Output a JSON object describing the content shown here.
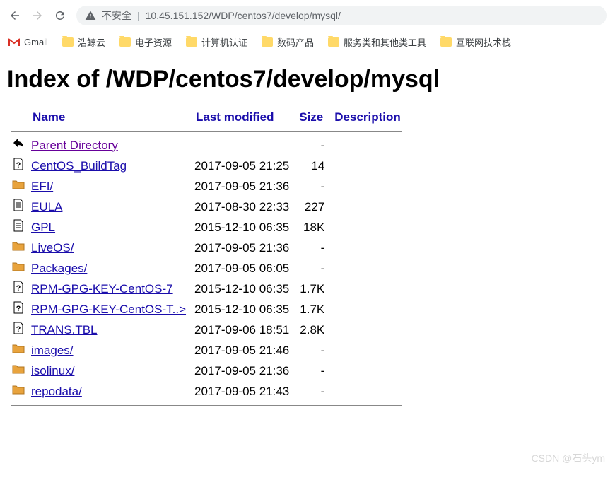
{
  "browser": {
    "security_label": "不安全",
    "url": "10.45.151.152/WDP/centos7/develop/mysql/"
  },
  "bookmarks": [
    {
      "label": "Gmail",
      "icon": "gmail"
    },
    {
      "label": "浩鲸云",
      "icon": "folder"
    },
    {
      "label": "电子资源",
      "icon": "folder"
    },
    {
      "label": "计算机认证",
      "icon": "folder"
    },
    {
      "label": "数码产品",
      "icon": "folder"
    },
    {
      "label": "服务类和其他类工具",
      "icon": "folder"
    },
    {
      "label": "互联网技术栈",
      "icon": "folder"
    }
  ],
  "page": {
    "heading": "Index of /WDP/centos7/develop/mysql",
    "columns": {
      "name": "Name",
      "modified": "Last modified",
      "size": "Size",
      "description": "Description"
    },
    "entries": [
      {
        "icon": "back",
        "name": "Parent Directory",
        "modified": "",
        "size": "-",
        "visited": true
      },
      {
        "icon": "unknown",
        "name": "CentOS_BuildTag",
        "modified": "2017-09-05 21:25",
        "size": "14"
      },
      {
        "icon": "folder",
        "name": "EFI/",
        "modified": "2017-09-05 21:36",
        "size": "-"
      },
      {
        "icon": "text",
        "name": "EULA",
        "modified": "2017-08-30 22:33",
        "size": "227"
      },
      {
        "icon": "text",
        "name": "GPL",
        "modified": "2015-12-10 06:35",
        "size": "18K"
      },
      {
        "icon": "folder",
        "name": "LiveOS/",
        "modified": "2017-09-05 21:36",
        "size": "-"
      },
      {
        "icon": "folder",
        "name": "Packages/",
        "modified": "2017-09-05 06:05",
        "size": "-"
      },
      {
        "icon": "unknown",
        "name": "RPM-GPG-KEY-CentOS-7",
        "modified": "2015-12-10 06:35",
        "size": "1.7K"
      },
      {
        "icon": "unknown",
        "name": "RPM-GPG-KEY-CentOS-T..>",
        "modified": "2015-12-10 06:35",
        "size": "1.7K"
      },
      {
        "icon": "unknown",
        "name": "TRANS.TBL",
        "modified": "2017-09-06 18:51",
        "size": "2.8K"
      },
      {
        "icon": "folder",
        "name": "images/",
        "modified": "2017-09-05 21:46",
        "size": "-"
      },
      {
        "icon": "folder",
        "name": "isolinux/",
        "modified": "2017-09-05 21:36",
        "size": "-"
      },
      {
        "icon": "folder",
        "name": "repodata/",
        "modified": "2017-09-05 21:43",
        "size": "-"
      }
    ]
  },
  "watermark": "CSDN @石头ym"
}
